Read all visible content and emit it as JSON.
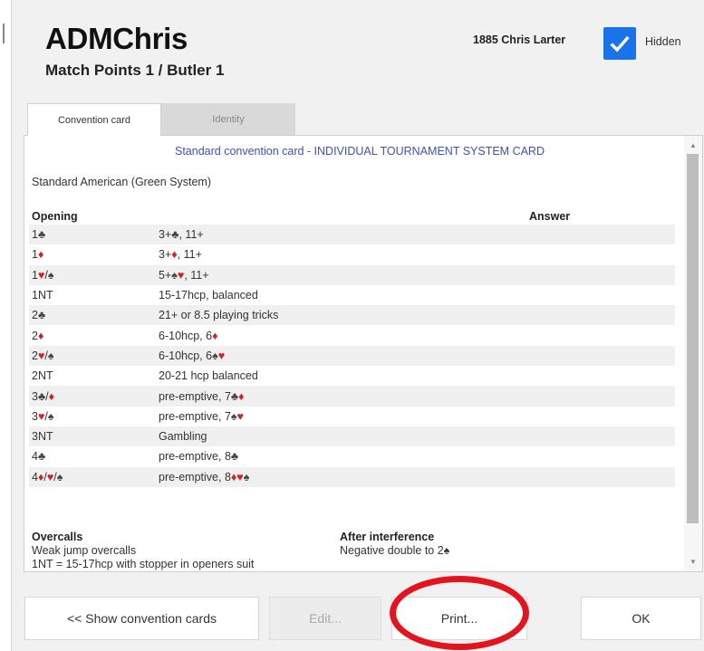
{
  "header": {
    "title": "ADMChris",
    "subtitle": "Match Points 1 / Butler 1",
    "player": "1885 Chris Larter",
    "hidden_label": "Hidden",
    "hidden_checked": true
  },
  "tabs": [
    {
      "label": "Convention card",
      "active": true
    },
    {
      "label": "Identity",
      "active": false
    }
  ],
  "card": {
    "heading": "Standard convention card - INDIVIDUAL TOURNAMENT SYSTEM CARD",
    "system": "Standard American (Green System)",
    "col_opening": "Opening",
    "col_answer": "Answer",
    "rows": [
      {
        "opening": [
          [
            "1",
            ""
          ],
          [
            "♣",
            "c"
          ]
        ],
        "desc": [
          [
            "3+",
            ""
          ],
          [
            "♣",
            "c"
          ],
          [
            ", 11+",
            ""
          ]
        ]
      },
      {
        "opening": [
          [
            "1",
            ""
          ],
          [
            "♦",
            "d"
          ]
        ],
        "desc": [
          [
            "3+",
            ""
          ],
          [
            "♦",
            "d"
          ],
          [
            ", 11+",
            ""
          ]
        ]
      },
      {
        "opening": [
          [
            "1",
            ""
          ],
          [
            "♥",
            "h"
          ],
          [
            "/",
            ""
          ],
          [
            "♠",
            "s"
          ]
        ],
        "desc": [
          [
            "5+",
            ""
          ],
          [
            "♠",
            "s"
          ],
          [
            "♥",
            "h"
          ],
          [
            ", 11+",
            ""
          ]
        ]
      },
      {
        "opening": [
          [
            "1NT",
            ""
          ]
        ],
        "desc": [
          [
            "15-17hcp, balanced",
            ""
          ]
        ]
      },
      {
        "opening": [
          [
            "2",
            ""
          ],
          [
            "♣",
            "c"
          ]
        ],
        "desc": [
          [
            "21+ or 8.5 playing tricks",
            ""
          ]
        ]
      },
      {
        "opening": [
          [
            "2",
            ""
          ],
          [
            "♦",
            "d"
          ]
        ],
        "desc": [
          [
            "6-10hcp, 6",
            ""
          ],
          [
            "♦",
            "d"
          ]
        ]
      },
      {
        "opening": [
          [
            "2",
            ""
          ],
          [
            "♥",
            "h"
          ],
          [
            "/",
            ""
          ],
          [
            "♠",
            "s"
          ]
        ],
        "desc": [
          [
            "6-10hcp, 6",
            ""
          ],
          [
            "♠",
            "s"
          ],
          [
            "♥",
            "h"
          ]
        ]
      },
      {
        "opening": [
          [
            "2NT",
            ""
          ]
        ],
        "desc": [
          [
            "20-21 hcp balanced",
            ""
          ]
        ]
      },
      {
        "opening": [
          [
            "3",
            ""
          ],
          [
            "♣",
            "c"
          ],
          [
            "/",
            ""
          ],
          [
            "♦",
            "d"
          ]
        ],
        "desc": [
          [
            "pre-emptive, 7",
            ""
          ],
          [
            "♣",
            "c"
          ],
          [
            "♦",
            "d"
          ]
        ]
      },
      {
        "opening": [
          [
            "3",
            ""
          ],
          [
            "♥",
            "h"
          ],
          [
            "/",
            ""
          ],
          [
            "♠",
            "s"
          ]
        ],
        "desc": [
          [
            "pre-emptive, 7",
            ""
          ],
          [
            "♠",
            "s"
          ],
          [
            "♥",
            "h"
          ]
        ]
      },
      {
        "opening": [
          [
            "3NT",
            ""
          ]
        ],
        "desc": [
          [
            "Gambling",
            ""
          ]
        ]
      },
      {
        "opening": [
          [
            "4",
            ""
          ],
          [
            "♣",
            "c"
          ]
        ],
        "desc": [
          [
            "pre-emptive, 8",
            ""
          ],
          [
            "♣",
            "c"
          ]
        ]
      },
      {
        "opening": [
          [
            "4",
            ""
          ],
          [
            "♦",
            "d"
          ],
          [
            "/",
            ""
          ],
          [
            "♥",
            "h"
          ],
          [
            "/",
            ""
          ],
          [
            "♠",
            "s"
          ]
        ],
        "desc": [
          [
            "pre-emptive, 8",
            ""
          ],
          [
            "♦",
            "d"
          ],
          [
            "♥",
            "h"
          ],
          [
            "♠",
            "s"
          ]
        ]
      }
    ],
    "overcalls": {
      "title": "Overcalls",
      "line1": "Weak jump overcalls",
      "line2": "1NT = 15-17hcp with stopper in openers suit"
    },
    "interference": {
      "title": "After interference",
      "line1": "Negative double to 2♠"
    }
  },
  "buttons": {
    "show": "<< Show convention cards",
    "edit": "Edit...",
    "print": "Print...",
    "ok": "OK"
  },
  "colors": {
    "accent": "#1a73e8",
    "heading_blue": "#3f51b5",
    "suit_red": "#d91e1e",
    "annotation_red": "#e4141e"
  }
}
